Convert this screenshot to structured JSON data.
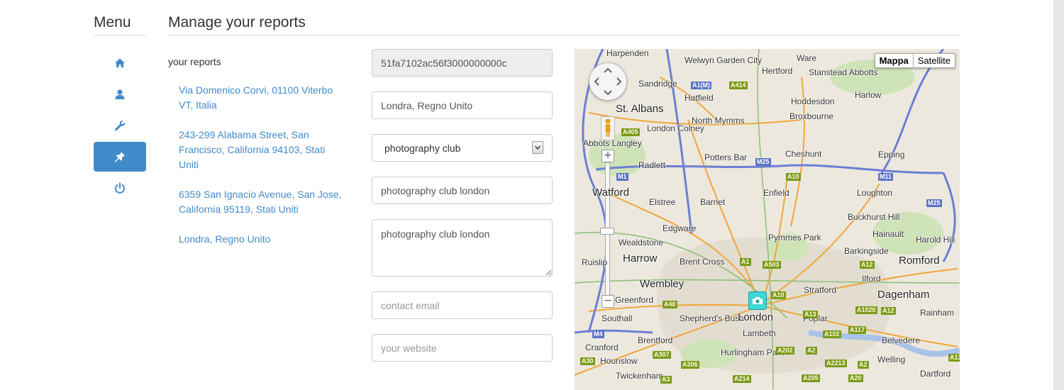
{
  "sidebar": {
    "title": "Menu",
    "items": [
      {
        "icon": "home-icon",
        "active": false
      },
      {
        "icon": "user-icon",
        "active": false
      },
      {
        "icon": "wrench-icon",
        "active": false
      },
      {
        "icon": "pushpin-icon",
        "active": true
      },
      {
        "icon": "power-icon",
        "active": false
      }
    ]
  },
  "page": {
    "title": "Manage your reports"
  },
  "reports": {
    "heading": "your reports",
    "items": [
      "Via Domenico Corvi, 01100 Viterbo VT, Italia",
      "243-299 Alabama Street, San Francisco, California 94103, Stati Uniti",
      "6359 San Ignacio Avenue, San Jose, California 95119, Stati Uniti",
      "Londra, Regno Unito"
    ]
  },
  "form": {
    "id_value": "51fa7102ac56f3000000000c",
    "location_value": "Londra, Regno Unito",
    "category_selected": "photography club",
    "name_value": "photography club london",
    "description_value": "photography club london",
    "email_placeholder": "contact email",
    "website_placeholder": "your website"
  },
  "map": {
    "type_map": "Mappa",
    "type_satellite": "Satellite",
    "zoom_in": "+",
    "zoom_out": "−",
    "labels": [
      "Harpenden",
      "Welwyn Garden City",
      "Ware",
      "Hertford",
      "Stanstead Abbotts",
      "Sandridge",
      "Hatfield",
      "Hoddesdon",
      "Harlow",
      "St. Albans",
      "Broxbourne",
      "North Mymms",
      "London Colney",
      "Abbots Langley",
      "Radlett",
      "Potters Bar",
      "Cheshunt",
      "Epping",
      "Watford",
      "Elstree",
      "Barnet",
      "Enfield",
      "Loughton",
      "Buckhurst Hill",
      "Edgware",
      "Pymmes Park",
      "Hainault",
      "Harold Hill",
      "Wealdstone",
      "Barkingside",
      "Harrow",
      "Brent Cross",
      "Romford",
      "Ruislip",
      "Wembley",
      "Ilford",
      "Stratford",
      "Dagenham",
      "Greenford",
      "Southall",
      "Shepherd's Bush",
      "London",
      "Poplar",
      "Rainham",
      "Lambeth",
      "Brentford",
      "Belvedere",
      "Cranford",
      "Hurlingham Park",
      "Hounslow",
      "Welling",
      "Twickenham",
      "Dartford"
    ],
    "roads": [
      "A1(M)",
      "A414",
      "A405",
      "M25",
      "A10",
      "M11",
      "M1",
      "M25",
      "A1",
      "A503",
      "A10",
      "A13",
      "A1020",
      "A117",
      "A102",
      "A12",
      "A12",
      "A40",
      "M4",
      "A307",
      "A306",
      "A202",
      "A2",
      "A205",
      "A214",
      "A3",
      "A30",
      "A2213",
      "A20",
      "A2",
      "A13"
    ]
  }
}
